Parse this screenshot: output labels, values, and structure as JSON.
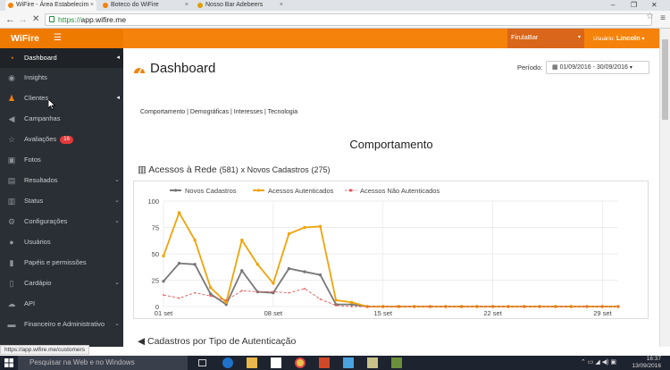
{
  "browser": {
    "tabs": [
      {
        "title": "WiFire - Área Estabelecim",
        "fav": "#f5820a"
      },
      {
        "title": "Boteco do WiFire",
        "fav": "#f5820a"
      },
      {
        "title": "Nosso Bar Adebeers",
        "fav": "#e0a000"
      }
    ],
    "url_scheme": "https://",
    "url_host": "app.wifire.me"
  },
  "app": {
    "brand": "WiFire",
    "venue": "FirulaBar",
    "user_prefix": "Usuário:",
    "user_name": "Lincoln"
  },
  "sidebar": {
    "items": [
      {
        "label": "Dashboard",
        "icon": "dashboard-icon",
        "badge": ""
      },
      {
        "label": "Insights",
        "icon": "eye-icon",
        "badge": ""
      },
      {
        "label": "Clientes",
        "icon": "users-icon",
        "badge": ""
      },
      {
        "label": "Campanhas",
        "icon": "megaphone-icon",
        "badge": ""
      },
      {
        "label": "Avaliações",
        "icon": "star-icon",
        "badge": "16"
      },
      {
        "label": "Fotos",
        "icon": "image-icon",
        "badge": ""
      },
      {
        "label": "Resultados",
        "icon": "table-icon",
        "badge": ""
      },
      {
        "label": "Status",
        "icon": "server-icon",
        "badge": ""
      },
      {
        "label": "Configurações",
        "icon": "gears-icon",
        "badge": ""
      },
      {
        "label": "Usuários",
        "icon": "user-icon",
        "badge": ""
      },
      {
        "label": "Papéis e permissões",
        "icon": "lock-icon",
        "badge": ""
      },
      {
        "label": "Cardápio",
        "icon": "book-icon",
        "badge": ""
      },
      {
        "label": "API",
        "icon": "code-icon",
        "badge": ""
      },
      {
        "label": "Financeiro e Administrativo",
        "icon": "money-icon",
        "badge": ""
      }
    ]
  },
  "main": {
    "title": "Dashboard",
    "period_label": "Período:",
    "period_value": "01/09/2016 - 30/09/2016",
    "subnav": "Comportamento | Demográficas | Interesses | Tecnologia",
    "section_title": "Comportamento",
    "chart_heading": "Acessos à Rede",
    "chart_heading_count1": "(581)",
    "chart_heading_mid": "x Novos Cadastros",
    "chart_heading_count2": "(275)",
    "next_heading": "Cadastros por Tipo de Autenticação"
  },
  "status_url": "https://app.wifire.me/customers",
  "taskbar": {
    "search_placeholder": "Pesquisar na Web e no Windows",
    "time": "16:37",
    "date": "13/09/2016"
  },
  "chart_data": {
    "type": "line",
    "x": [
      1,
      2,
      3,
      4,
      5,
      6,
      7,
      8,
      9,
      10,
      11,
      12,
      13,
      14,
      15,
      16,
      17,
      18,
      19,
      20,
      21,
      22,
      23,
      24,
      25,
      26,
      27,
      28,
      29,
      30
    ],
    "xticks": [
      {
        "x": 1,
        "label": "01 set"
      },
      {
        "x": 8,
        "label": "08 set"
      },
      {
        "x": 15,
        "label": "15 set"
      },
      {
        "x": 22,
        "label": "22 set"
      },
      {
        "x": 29,
        "label": "29 set"
      }
    ],
    "yticks": [
      0,
      25,
      50,
      75,
      100
    ],
    "ylim": [
      0,
      100
    ],
    "series": [
      {
        "name": "Novos Cadastros",
        "color": "#777777",
        "style": "solid",
        "values": [
          24,
          41,
          40,
          12,
          2,
          34,
          14,
          13,
          36,
          33,
          30,
          2,
          2,
          0,
          0,
          0,
          0,
          0,
          0,
          0,
          0,
          0,
          0,
          0,
          0,
          0,
          0,
          0,
          0,
          0
        ]
      },
      {
        "name": "Acessos Autenticados",
        "color": "#f0a30a",
        "style": "solid",
        "values": [
          48,
          89,
          63,
          18,
          4,
          63,
          40,
          22,
          69,
          75,
          76,
          6,
          4,
          0,
          0,
          0,
          0,
          0,
          0,
          0,
          0,
          0,
          0,
          0,
          0,
          0,
          0,
          0,
          0,
          0
        ]
      },
      {
        "name": "Acessos Não Autenticados",
        "color": "#e05555",
        "style": "dashed",
        "values": [
          11,
          8,
          13,
          10,
          6,
          15,
          14,
          14,
          13,
          17,
          7,
          1,
          0,
          0,
          0,
          0,
          0,
          0,
          0,
          0,
          0,
          0,
          0,
          0,
          0,
          0,
          0,
          0,
          0,
          0
        ]
      }
    ]
  }
}
